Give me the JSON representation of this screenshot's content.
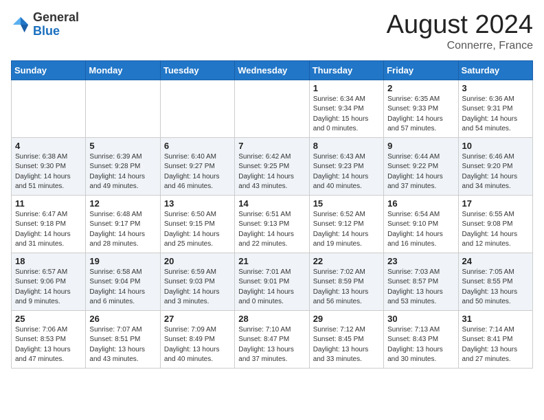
{
  "logo": {
    "general": "General",
    "blue": "Blue"
  },
  "header": {
    "month": "August 2024",
    "location": "Connerre, France"
  },
  "days_of_week": [
    "Sunday",
    "Monday",
    "Tuesday",
    "Wednesday",
    "Thursday",
    "Friday",
    "Saturday"
  ],
  "weeks": [
    [
      {
        "day": "",
        "info": ""
      },
      {
        "day": "",
        "info": ""
      },
      {
        "day": "",
        "info": ""
      },
      {
        "day": "",
        "info": ""
      },
      {
        "day": "1",
        "info": "Sunrise: 6:34 AM\nSunset: 9:34 PM\nDaylight: 15 hours\nand 0 minutes."
      },
      {
        "day": "2",
        "info": "Sunrise: 6:35 AM\nSunset: 9:33 PM\nDaylight: 14 hours\nand 57 minutes."
      },
      {
        "day": "3",
        "info": "Sunrise: 6:36 AM\nSunset: 9:31 PM\nDaylight: 14 hours\nand 54 minutes."
      }
    ],
    [
      {
        "day": "4",
        "info": "Sunrise: 6:38 AM\nSunset: 9:30 PM\nDaylight: 14 hours\nand 51 minutes."
      },
      {
        "day": "5",
        "info": "Sunrise: 6:39 AM\nSunset: 9:28 PM\nDaylight: 14 hours\nand 49 minutes."
      },
      {
        "day": "6",
        "info": "Sunrise: 6:40 AM\nSunset: 9:27 PM\nDaylight: 14 hours\nand 46 minutes."
      },
      {
        "day": "7",
        "info": "Sunrise: 6:42 AM\nSunset: 9:25 PM\nDaylight: 14 hours\nand 43 minutes."
      },
      {
        "day": "8",
        "info": "Sunrise: 6:43 AM\nSunset: 9:23 PM\nDaylight: 14 hours\nand 40 minutes."
      },
      {
        "day": "9",
        "info": "Sunrise: 6:44 AM\nSunset: 9:22 PM\nDaylight: 14 hours\nand 37 minutes."
      },
      {
        "day": "10",
        "info": "Sunrise: 6:46 AM\nSunset: 9:20 PM\nDaylight: 14 hours\nand 34 minutes."
      }
    ],
    [
      {
        "day": "11",
        "info": "Sunrise: 6:47 AM\nSunset: 9:18 PM\nDaylight: 14 hours\nand 31 minutes."
      },
      {
        "day": "12",
        "info": "Sunrise: 6:48 AM\nSunset: 9:17 PM\nDaylight: 14 hours\nand 28 minutes."
      },
      {
        "day": "13",
        "info": "Sunrise: 6:50 AM\nSunset: 9:15 PM\nDaylight: 14 hours\nand 25 minutes."
      },
      {
        "day": "14",
        "info": "Sunrise: 6:51 AM\nSunset: 9:13 PM\nDaylight: 14 hours\nand 22 minutes."
      },
      {
        "day": "15",
        "info": "Sunrise: 6:52 AM\nSunset: 9:12 PM\nDaylight: 14 hours\nand 19 minutes."
      },
      {
        "day": "16",
        "info": "Sunrise: 6:54 AM\nSunset: 9:10 PM\nDaylight: 14 hours\nand 16 minutes."
      },
      {
        "day": "17",
        "info": "Sunrise: 6:55 AM\nSunset: 9:08 PM\nDaylight: 14 hours\nand 12 minutes."
      }
    ],
    [
      {
        "day": "18",
        "info": "Sunrise: 6:57 AM\nSunset: 9:06 PM\nDaylight: 14 hours\nand 9 minutes."
      },
      {
        "day": "19",
        "info": "Sunrise: 6:58 AM\nSunset: 9:04 PM\nDaylight: 14 hours\nand 6 minutes."
      },
      {
        "day": "20",
        "info": "Sunrise: 6:59 AM\nSunset: 9:03 PM\nDaylight: 14 hours\nand 3 minutes."
      },
      {
        "day": "21",
        "info": "Sunrise: 7:01 AM\nSunset: 9:01 PM\nDaylight: 14 hours\nand 0 minutes."
      },
      {
        "day": "22",
        "info": "Sunrise: 7:02 AM\nSunset: 8:59 PM\nDaylight: 13 hours\nand 56 minutes."
      },
      {
        "day": "23",
        "info": "Sunrise: 7:03 AM\nSunset: 8:57 PM\nDaylight: 13 hours\nand 53 minutes."
      },
      {
        "day": "24",
        "info": "Sunrise: 7:05 AM\nSunset: 8:55 PM\nDaylight: 13 hours\nand 50 minutes."
      }
    ],
    [
      {
        "day": "25",
        "info": "Sunrise: 7:06 AM\nSunset: 8:53 PM\nDaylight: 13 hours\nand 47 minutes."
      },
      {
        "day": "26",
        "info": "Sunrise: 7:07 AM\nSunset: 8:51 PM\nDaylight: 13 hours\nand 43 minutes."
      },
      {
        "day": "27",
        "info": "Sunrise: 7:09 AM\nSunset: 8:49 PM\nDaylight: 13 hours\nand 40 minutes."
      },
      {
        "day": "28",
        "info": "Sunrise: 7:10 AM\nSunset: 8:47 PM\nDaylight: 13 hours\nand 37 minutes."
      },
      {
        "day": "29",
        "info": "Sunrise: 7:12 AM\nSunset: 8:45 PM\nDaylight: 13 hours\nand 33 minutes."
      },
      {
        "day": "30",
        "info": "Sunrise: 7:13 AM\nSunset: 8:43 PM\nDaylight: 13 hours\nand 30 minutes."
      },
      {
        "day": "31",
        "info": "Sunrise: 7:14 AM\nSunset: 8:41 PM\nDaylight: 13 hours\nand 27 minutes."
      }
    ]
  ]
}
